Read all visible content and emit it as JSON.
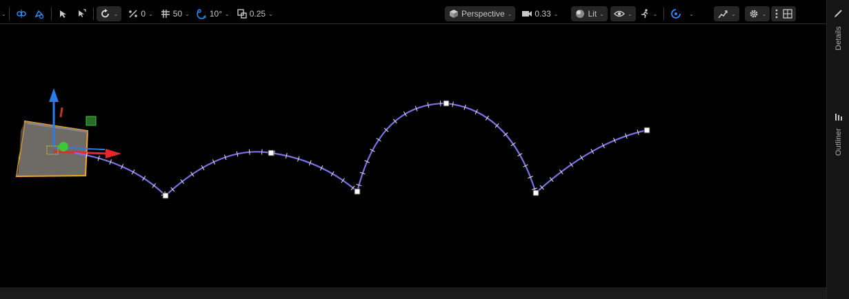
{
  "toolbar": {
    "snap_angle_value": "0",
    "grid_snap_value": "50",
    "rotation_snap_value": "10°",
    "scale_snap_value": "0.25",
    "view_mode_label": "Perspective",
    "camera_speed_value": "0.33",
    "lighting_mode_label": "Lit"
  },
  "side_panel": {
    "details_label": "Details",
    "outliner_label": "Outliner"
  },
  "colors": {
    "spline": "#7c72e6",
    "selection_outline": "#f5a623",
    "gizmo_x": "#e8262b",
    "gizmo_y": "#3cc63c",
    "gizmo_z": "#2a7de8",
    "accent": "#2f8cf5"
  },
  "icons": [
    "selection-icon",
    "brush-select-icon",
    "select-mode-icon",
    "transform-icon",
    "rotate-icon",
    "surface-snap-icon",
    "grid-snap-icon",
    "rotation-snap-icon",
    "scale-snap-icon",
    "perspective-cube-icon",
    "camera-speed-icon",
    "lit-sphere-icon",
    "eye-icon",
    "game-mode-runner-icon",
    "realtime-icon",
    "stats-icon",
    "settings-gear-icon",
    "more-options-icon",
    "layout-grid-icon",
    "brush-icon",
    "outliner-icon"
  ]
}
